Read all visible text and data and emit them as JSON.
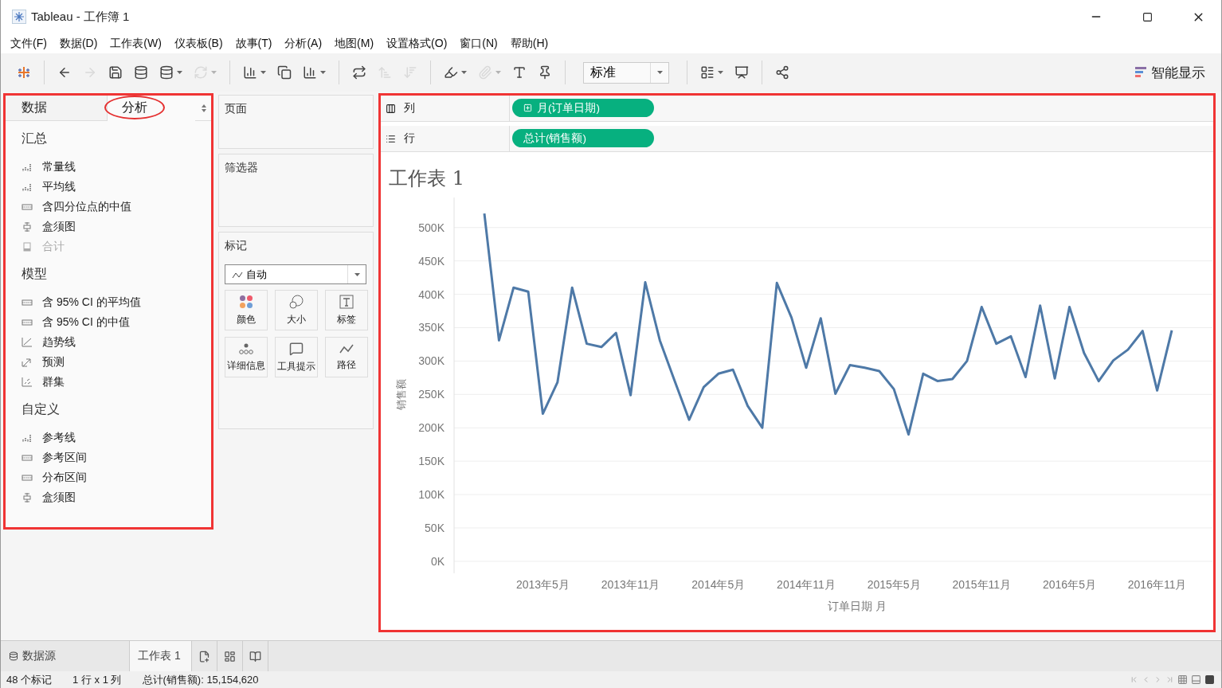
{
  "window": {
    "title": "Tableau - 工作簿 1"
  },
  "menu": [
    "文件(F)",
    "数据(D)",
    "工作表(W)",
    "仪表板(B)",
    "故事(T)",
    "分析(A)",
    "地图(M)",
    "设置格式(O)",
    "窗口(N)",
    "帮助(H)"
  ],
  "toolbar": {
    "groups": [
      {
        "items": [
          {
            "kind": "logo",
            "disabled": false,
            "caret": false
          }
        ]
      },
      {
        "items": [
          {
            "kind": "back",
            "disabled": false,
            "caret": false
          },
          {
            "kind": "forward",
            "disabled": true,
            "caret": false
          },
          {
            "kind": "save",
            "disabled": false,
            "caret": false
          },
          {
            "kind": "newdata",
            "disabled": false,
            "caret": false
          },
          {
            "kind": "pause",
            "disabled": false,
            "caret": true
          },
          {
            "kind": "refresh",
            "disabled": true,
            "caret": true
          }
        ]
      },
      {
        "items": [
          {
            "kind": "newsheet",
            "disabled": false,
            "caret": true
          },
          {
            "kind": "duplicate",
            "disabled": false,
            "caret": false
          },
          {
            "kind": "clear",
            "disabled": false,
            "caret": true
          }
        ]
      },
      {
        "items": [
          {
            "kind": "swap",
            "disabled": false,
            "caret": false
          },
          {
            "kind": "sortasc",
            "disabled": true,
            "caret": false
          },
          {
            "kind": "sortdesc",
            "disabled": true,
            "caret": false
          }
        ]
      },
      {
        "items": [
          {
            "kind": "highlight",
            "disabled": false,
            "caret": true
          },
          {
            "kind": "clip",
            "disabled": true,
            "caret": true
          },
          {
            "kind": "text",
            "disabled": false,
            "caret": false
          },
          {
            "kind": "pin",
            "disabled": false,
            "caret": false
          }
        ]
      }
    ],
    "fit": "标准",
    "after_groups": [
      {
        "items": [
          {
            "kind": "cards",
            "disabled": false,
            "caret": true
          },
          {
            "kind": "present",
            "disabled": false,
            "caret": false
          }
        ]
      },
      {
        "items": [
          {
            "kind": "share",
            "disabled": false,
            "caret": false
          }
        ]
      }
    ],
    "show_me": "智能显示"
  },
  "side_tabs": [
    {
      "label": "数据",
      "selected": false
    },
    {
      "label": "分析",
      "selected": true
    }
  ],
  "analytics": [
    {
      "heading": "汇总",
      "items": [
        {
          "label": "常量线",
          "kind": "bars",
          "disabled": false
        },
        {
          "label": "平均线",
          "kind": "bars",
          "disabled": false
        },
        {
          "label": "含四分位点的中值",
          "kind": "band",
          "disabled": false
        },
        {
          "label": "盒须图",
          "kind": "box",
          "disabled": false
        },
        {
          "label": "合计",
          "kind": "total",
          "disabled": true
        }
      ]
    },
    {
      "heading": "模型",
      "items": [
        {
          "label": "含 95% CI 的平均值",
          "kind": "band",
          "disabled": false
        },
        {
          "label": "含 95% CI 的中值",
          "kind": "band",
          "disabled": false
        },
        {
          "label": "趋势线",
          "kind": "trend",
          "disabled": false
        },
        {
          "label": "预测",
          "kind": "forecast",
          "disabled": false
        },
        {
          "label": "群集",
          "kind": "cluster",
          "disabled": false
        }
      ]
    },
    {
      "heading": "自定义",
      "items": [
        {
          "label": "参考线",
          "kind": "bars",
          "disabled": false
        },
        {
          "label": "参考区间",
          "kind": "band",
          "disabled": false
        },
        {
          "label": "分布区间",
          "kind": "band",
          "disabled": false
        },
        {
          "label": "盒须图",
          "kind": "box",
          "disabled": false
        }
      ]
    }
  ],
  "cards": {
    "pages": "页面",
    "filters": "筛选器",
    "marks": {
      "title": "标记",
      "mark_type": "自动",
      "buttons": [
        {
          "label": "颜色",
          "kind": "color"
        },
        {
          "label": "大小",
          "kind": "size"
        },
        {
          "label": "标签",
          "kind": "label"
        },
        {
          "label": "详细信息",
          "kind": "detail"
        },
        {
          "label": "工具提示",
          "kind": "tooltip"
        },
        {
          "label": "路径",
          "kind": "path"
        }
      ]
    }
  },
  "shelves": [
    {
      "label": "列",
      "kind": "columns",
      "pill": "月(订单日期)",
      "expandable": true
    },
    {
      "label": "行",
      "kind": "rows",
      "pill": "总计(销售额)",
      "expandable": false
    }
  ],
  "sheet": {
    "title": "工作表 1",
    "chart_data": {
      "type": "line",
      "xlabel": "订单日期 月",
      "ylabel": "销售额",
      "grid": true,
      "categories": [
        null,
        null,
        null,
        null,
        "2013年5月",
        null,
        null,
        null,
        null,
        null,
        "2013年11月",
        null,
        null,
        null,
        null,
        null,
        "2014年5月",
        null,
        null,
        null,
        null,
        null,
        "2014年11月",
        null,
        null,
        null,
        null,
        null,
        "2015年5月",
        null,
        null,
        null,
        null,
        null,
        "2015年11月",
        null,
        null,
        null,
        null,
        null,
        "2016年5月",
        null,
        null,
        null,
        null,
        null,
        "2016年11月",
        null
      ],
      "series": [
        {
          "color": "#4e79a7",
          "values": [
            521000,
            331000,
            410000,
            404000,
            221000,
            268000,
            410000,
            326000,
            321000,
            342000,
            249000,
            418000,
            331000,
            271000,
            212000,
            261000,
            281000,
            287000,
            233000,
            200000,
            417000,
            365000,
            290000,
            364000,
            251000,
            294000,
            290000,
            285000,
            258000,
            190000,
            281000,
            270000,
            273000,
            300000,
            381000,
            326000,
            337000,
            276000,
            383000,
            274000,
            381000,
            312000,
            270000,
            301000,
            317000,
            345000,
            256000,
            346000
          ]
        }
      ],
      "ylim": [
        -18000,
        545000
      ],
      "yticks": [
        {
          "value": 0,
          "label": "0K"
        },
        {
          "value": 50000,
          "label": "50K"
        },
        {
          "value": 100000,
          "label": "100K"
        },
        {
          "value": 150000,
          "label": "150K"
        },
        {
          "value": 200000,
          "label": "200K"
        },
        {
          "value": 250000,
          "label": "250K"
        },
        {
          "value": 300000,
          "label": "300K"
        },
        {
          "value": 350000,
          "label": "350K"
        },
        {
          "value": 400000,
          "label": "400K"
        },
        {
          "value": 450000,
          "label": "450K"
        },
        {
          "value": 500000,
          "label": "500K"
        }
      ]
    }
  },
  "sheet_tabs": [
    {
      "label": "数据源",
      "kind": "datasource",
      "selected": false
    },
    {
      "label": "工作表 1",
      "kind": "sheet",
      "selected": true
    }
  ],
  "status_bar": [
    "48 个标记",
    "1 行 x 1 列",
    "总计(销售额): 15,154,620"
  ]
}
